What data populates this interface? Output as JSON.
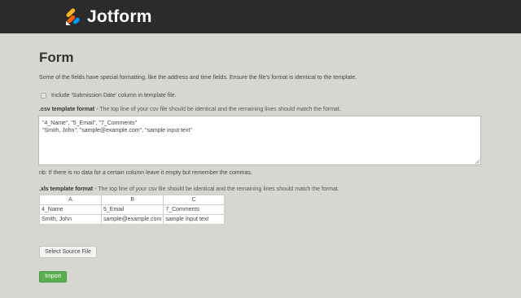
{
  "header": {
    "brand_name": "Jotform",
    "logo_icon": "jotform-logo-icon",
    "background_color": "#2b2b2b",
    "logo_colors": [
      "#ff6100",
      "#ffb629",
      "#0099ff"
    ]
  },
  "page": {
    "title": "Form",
    "intro": "Some of the fields have special formatting, like the address and time fields. Ensure the file's format is identical to the template.",
    "background_color": "#d7d7d2"
  },
  "submission_date_option": {
    "label": "Include 'Submission Date' column in template file.",
    "checked": false
  },
  "csv_section": {
    "title": ".csv template format",
    "description": " - The top line of your csv file should be identical and the remaining lines should match the format.",
    "lines": [
      "\"4_Name\", \"5_Email\", \"7_Comments\"",
      "\"Smith, John\", \"sample@example.com\", \"sample input text\""
    ]
  },
  "nb_note": "nb: If there is no data for a certain column leave it empty but remember the commas.",
  "xls_section": {
    "title": ".xls template format",
    "description": " - The top line of your csv file should be identical and the remaining lines should match the format.",
    "columns": [
      "A",
      "B",
      "C"
    ],
    "rows": [
      [
        "4_Name",
        "5_Email",
        "7_Comments"
      ],
      [
        "Smith, John",
        "sample@example.com",
        "sample input text"
      ]
    ]
  },
  "buttons": {
    "select_source_file": "Select Source File",
    "import": "Import",
    "import_color": "#5bad4f"
  }
}
